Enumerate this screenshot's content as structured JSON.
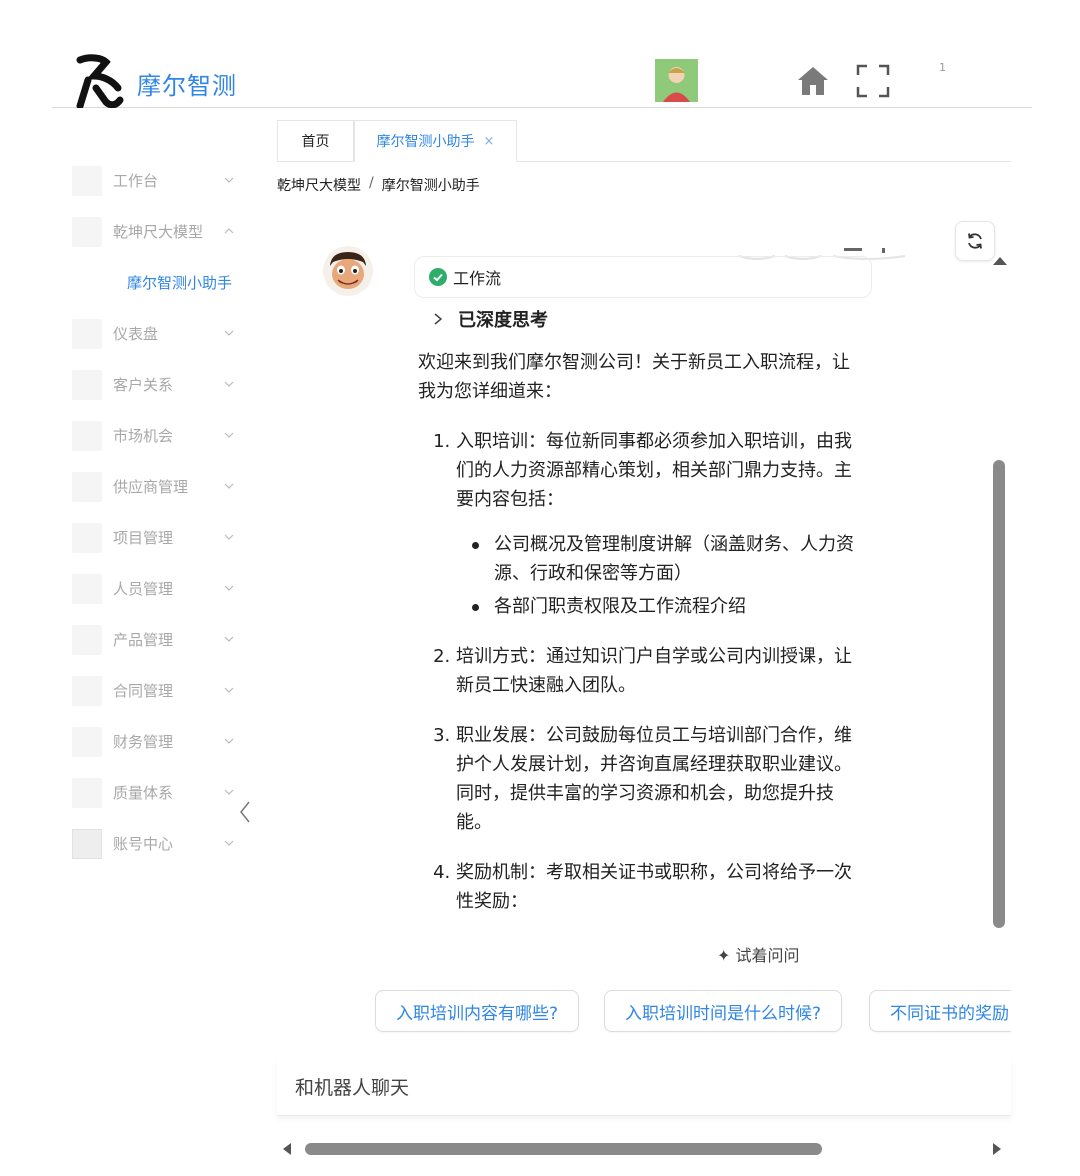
{
  "app": {
    "brand": "摩尔智测",
    "notification_count": "1"
  },
  "sidebar": {
    "items": [
      {
        "label": "工作台",
        "expanded": false
      },
      {
        "label": "乾坤尺大模型",
        "expanded": true
      },
      {
        "label": "仪表盘",
        "expanded": false
      },
      {
        "label": "客户关系",
        "expanded": false
      },
      {
        "label": "市场机会",
        "expanded": false
      },
      {
        "label": "供应商管理",
        "expanded": false
      },
      {
        "label": "项目管理",
        "expanded": false
      },
      {
        "label": "人员管理",
        "expanded": false
      },
      {
        "label": "产品管理",
        "expanded": false
      },
      {
        "label": "合同管理",
        "expanded": false
      },
      {
        "label": "财务管理",
        "expanded": false
      },
      {
        "label": "质量体系",
        "expanded": false
      },
      {
        "label": "账号中心",
        "expanded": false
      }
    ],
    "submenu_active": "摩尔智测小助手"
  },
  "tabs": [
    {
      "label": "首页"
    },
    {
      "label": "摩尔智测小助手",
      "close": "×"
    }
  ],
  "breadcrumb": {
    "parent": "乾坤尺大模型",
    "sep": "/",
    "current": "摩尔智测小助手"
  },
  "chat": {
    "workflow_label": "工作流",
    "deep_think_label": "已深度思考",
    "intro": "欢迎来到我们摩尔智测公司！关于新员工入职流程，让我为您详细道来：",
    "steps": [
      {
        "text": "入职培训：每位新同事都必须参加入职培训，由我们的人力资源部精心策划，相关部门鼎力支持。主要内容包括："
      },
      {
        "text": "培训方式：通过知识门户自学或公司内训授课，让新员工快速融入团队。"
      },
      {
        "text": "职业发展：公司鼓励每位员工与培训部门合作，维护个人发展计划，并咨询直属经理获取职业建议。同时，提供丰富的学习资源和机会，助您提升技能。"
      },
      {
        "text": "奖励机制：考取相关证书或职称，公司将给予一次性奖励："
      }
    ],
    "step1_bullets": [
      "公司概况及管理制度讲解（涵盖财务、人力资源、行政和保密等方面）",
      "各部门职责权限及工作流程介绍"
    ],
    "try_ask_label": "✦ 试着问问",
    "suggestions": [
      "入职培训内容有哪些?",
      "入职培训时间是什么时候?",
      "不同证书的奖励"
    ],
    "input_placeholder": "和机器人聊天"
  },
  "colors": {
    "accent": "#2f86e6",
    "muted": "#a8a8a8",
    "text": "#222222"
  },
  "icons": [
    "logo-icon",
    "avatar",
    "home-icon",
    "fullscreen-icon",
    "chevron-down-icon",
    "chevron-up-icon",
    "collapse-sidebar-icon",
    "refresh-icon",
    "bot-avatar",
    "check-circle-icon",
    "chevron-right-icon"
  ]
}
